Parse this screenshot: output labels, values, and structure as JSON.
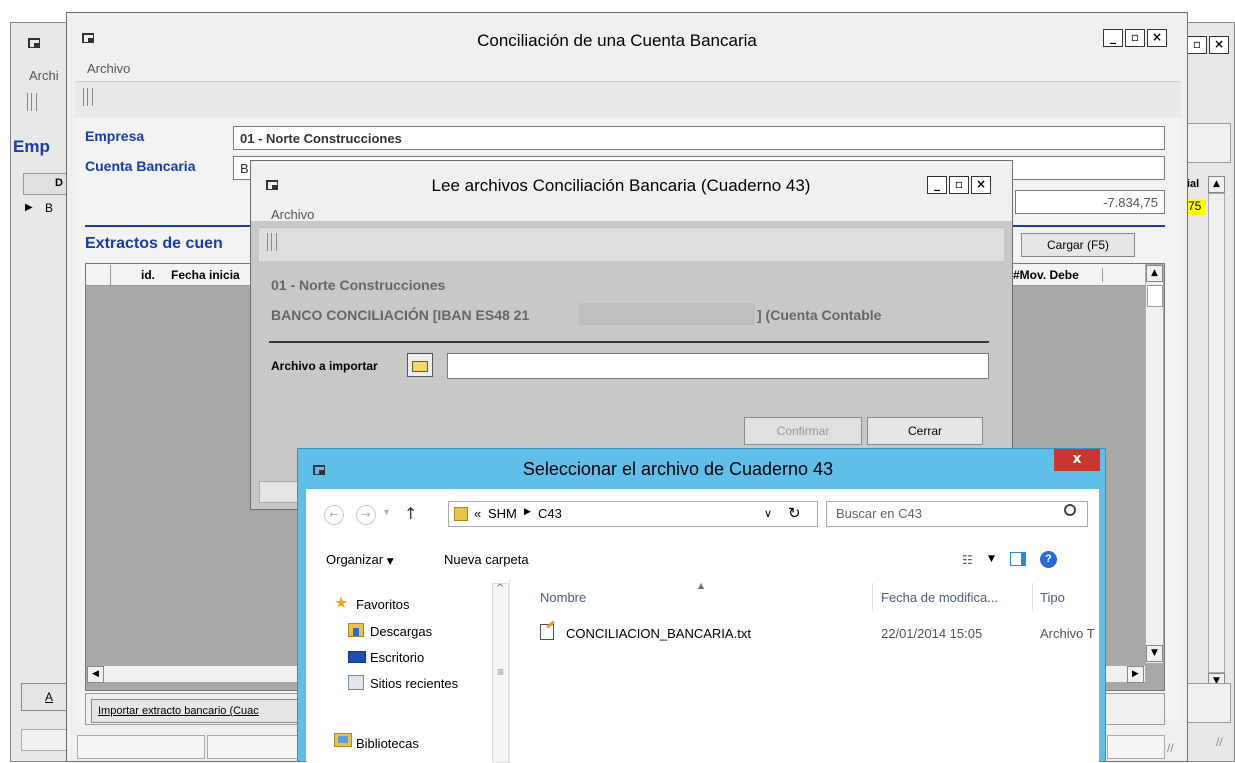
{
  "back_window": {
    "menu": "Archi",
    "heading": "Emp",
    "col_d": "D",
    "row_b": "B",
    "col_right": "ial",
    "value_highlight": "75",
    "bottom_btn": "A"
  },
  "main_window": {
    "title": "Conciliación de una Cuenta Bancaria",
    "menu_archivo": "Archivo",
    "empresa_label": "Empresa",
    "empresa_value": "01 - Norte Construcciones",
    "cuenta_label": "Cuenta Bancaria",
    "cuenta_value": "B",
    "amount": "-7.834,75",
    "extractos_heading": "Extractos de cuen",
    "col_id": "id.",
    "col_fecha": "Fecha inicia",
    "col_mov_debe": "#Mov. Debe",
    "cargar_btn": "Cargar (F5)",
    "importar_btn": "Importar extracto bancario (Cuac"
  },
  "lee_window": {
    "title": "Lee archivos Conciliación Bancaria (Cuaderno 43)",
    "menu_archivo": "Archivo",
    "company": "01 - Norte Construcciones",
    "bank_prefix": "BANCO CONCILIACIÓN [IBAN ES48 21",
    "bank_suffix": "] (Cuenta Contable",
    "archivo_label": "Archivo a importar",
    "archivo_value": "",
    "confirmar_btn": "Confirmar",
    "cerrar_btn": "Cerrar"
  },
  "file_dialog": {
    "title": "Seleccionar el archivo de Cuaderno 43",
    "path_prefix": "«",
    "path_1": "SHM",
    "path_2": "C43",
    "search_placeholder": "Buscar en C43",
    "organizar": "Organizar",
    "nueva_carpeta": "Nueva carpeta",
    "nav": [
      {
        "label": "Favoritos",
        "icon": "star-icon"
      },
      {
        "label": "Descargas",
        "icon": "downloads-folder-icon"
      },
      {
        "label": "Escritorio",
        "icon": "desktop-icon"
      },
      {
        "label": "Sitios recientes",
        "icon": "recent-places-icon"
      },
      {
        "label": "Bibliotecas",
        "icon": "libraries-icon"
      }
    ],
    "columns": {
      "name": "Nombre",
      "date": "Fecha de modifica...",
      "type": "Tipo"
    },
    "files": [
      {
        "name": "CONCILIACION_BANCARIA.txt",
        "date": "22/01/2014 15:05",
        "type": "Archivo T"
      }
    ]
  },
  "colors": {
    "accent_blue": "#1c3aa8",
    "dialog_frame": "#5fbfe8",
    "highlight_yellow": "#ffff00",
    "close_red": "#c7372f"
  }
}
